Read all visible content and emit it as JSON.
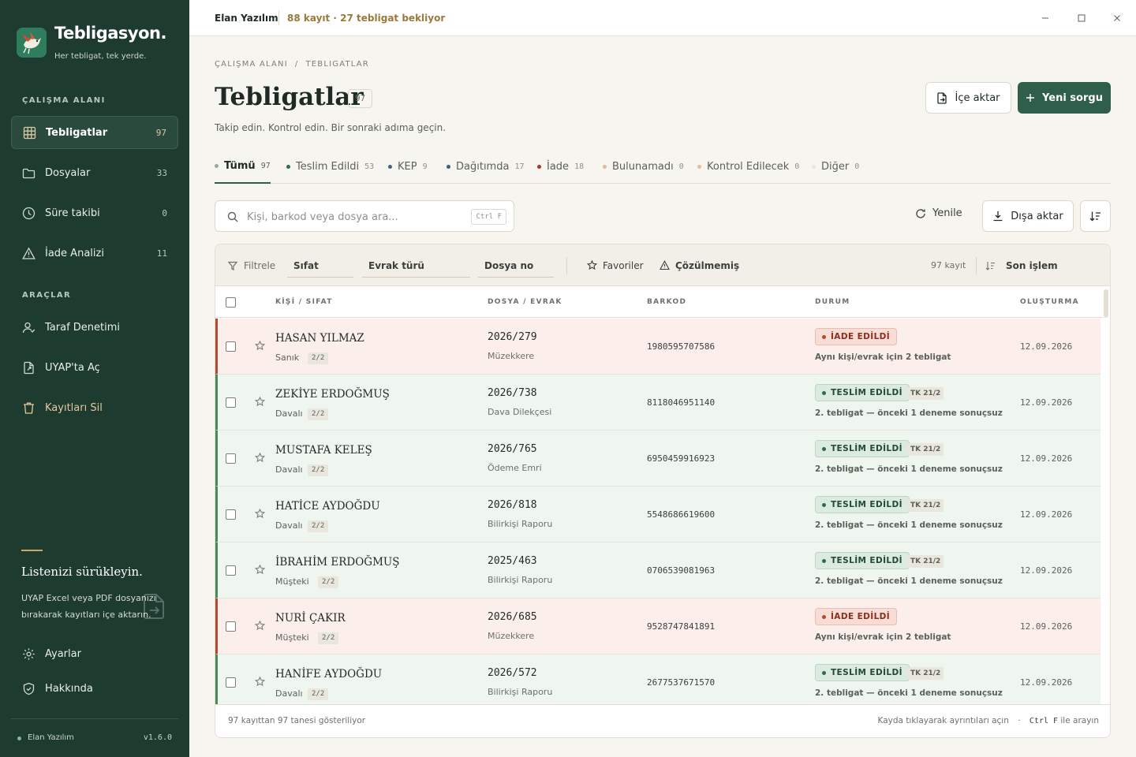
{
  "app": {
    "brand_name": "Tebligasyon.",
    "brand_tagline": "Her tebligat, tek yerde.",
    "company": "Elan Yazılım",
    "status": "88 kayıt · 27 tebligat bekliyor",
    "version": "v1.6.0"
  },
  "sidebar": {
    "section_workspace": "ÇALIŞMA ALANI",
    "section_tools": "ARAÇLAR",
    "nav": [
      {
        "label": "Tebligatlar",
        "count": "97",
        "icon": "table-icon",
        "active": true
      },
      {
        "label": "Dosyalar",
        "count": "33",
        "icon": "folder-icon"
      },
      {
        "label": "Süre takibi",
        "count": "0",
        "icon": "clock-icon"
      },
      {
        "label": "İade Analizi",
        "count": "11",
        "icon": "warning-icon"
      }
    ],
    "tools": [
      {
        "label": "Taraf Denetimi",
        "icon": "user-check-icon"
      },
      {
        "label": "UYAP'ta Aç",
        "icon": "external-file-icon"
      },
      {
        "label": "Kayıtları Sil",
        "icon": "trash-icon"
      }
    ],
    "drop_title": "Listenizi sürükleyin.",
    "drop_desc": "UYAP Excel veya PDF dosyanızı bırakarak kayıtları içe aktarın.",
    "settings_label": "Ayarlar",
    "about_label": "Hakkında"
  },
  "header": {
    "breadcrumb": [
      "ÇALIŞMA ALANI",
      "/",
      "TEBLIGATLAR"
    ],
    "title": "Tebligatlar",
    "count": "97",
    "subtitle": "Takip edin. Kontrol edin. Bir sonraki adıma geçin.",
    "import_label": "İçe aktar",
    "new_query_label": "Yeni sorgu"
  },
  "tabs": [
    {
      "label": "Tümü",
      "count": "97",
      "color": "#9aa89f",
      "active": true
    },
    {
      "label": "Teslim Edildi",
      "count": "53",
      "color": "#2f6b45"
    },
    {
      "label": "KEP",
      "count": "9",
      "color": "#4a5f86"
    },
    {
      "label": "Dağıtımda",
      "count": "17",
      "color": "#3e5f7a"
    },
    {
      "label": "İade",
      "count": "18",
      "color": "#a8361f"
    },
    {
      "label": "Bulunamadı",
      "count": "0",
      "color": "#e3b8a8"
    },
    {
      "label": "Kontrol Edilecek",
      "count": "0",
      "color": "#e8b9a2"
    },
    {
      "label": "Diğer",
      "count": "0",
      "color": "#e8e6dd"
    }
  ],
  "toolbar": {
    "search_placeholder": "Kişi, barkod veya dosya ara...",
    "search_shortcut": "Ctrl F",
    "refresh_label": "Yenile",
    "export_label": "Dışa aktar"
  },
  "filters": {
    "filter_label": "Filtrele",
    "sifat": "Sıfat",
    "evrak": "Evrak türü",
    "dosya": "Dosya no",
    "favorites": "Favoriler",
    "unresolved": "Çözülmemiş",
    "record_count": "97 kayıt",
    "sort_label": "Son işlem"
  },
  "table": {
    "columns": [
      "KİŞİ / SIFAT",
      "DOSYA / EVRAK",
      "BARKOD",
      "DURUM",
      "OLUŞTURMA"
    ],
    "rows": [
      {
        "name": "HASAN YILMAZ",
        "role": "Sanık",
        "pill": "2/2",
        "file": "2026/279",
        "doc": "Müzekkere",
        "barcode": "1980595707586",
        "status": "İADE EDİLDİ",
        "kind": "iade",
        "tk": "",
        "note": "Aynı kişi/evrak için 2 tebligat",
        "date": "12.09.2026"
      },
      {
        "name": "ZEKİYE ERDOĞMUŞ",
        "role": "Davalı",
        "pill": "2/2",
        "file": "2026/738",
        "doc": "Dava Dilekçesi",
        "barcode": "8118046951140",
        "status": "TESLİM EDİLDİ",
        "kind": "teslim",
        "tk": "TK 21/2",
        "note": "2. tebligat — önceki 1 deneme sonuçsuz",
        "date": "12.09.2026"
      },
      {
        "name": "MUSTAFA KELEŞ",
        "role": "Davalı",
        "pill": "2/2",
        "file": "2026/765",
        "doc": "Ödeme Emri",
        "barcode": "6950459916923",
        "status": "TESLİM EDİLDİ",
        "kind": "teslim",
        "tk": "TK 21/2",
        "note": "2. tebligat — önceki 1 deneme sonuçsuz",
        "date": "12.09.2026"
      },
      {
        "name": "HATİCE AYDOĞDU",
        "role": "Davalı",
        "pill": "2/2",
        "file": "2026/818",
        "doc": "Bilirkişi Raporu",
        "barcode": "5548686619600",
        "status": "TESLİM EDİLDİ",
        "kind": "teslim",
        "tk": "TK 21/2",
        "note": "2. tebligat — önceki 1 deneme sonuçsuz",
        "date": "12.09.2026"
      },
      {
        "name": "İBRAHİM ERDOĞMUŞ",
        "role": "Müşteki",
        "pill": "2/2",
        "file": "2025/463",
        "doc": "Bilirkişi Raporu",
        "barcode": "0706539081963",
        "status": "TESLİM EDİLDİ",
        "kind": "teslim",
        "tk": "TK 21/2",
        "note": "2. tebligat — önceki 1 deneme sonuçsuz",
        "date": "12.09.2026"
      },
      {
        "name": "NURİ ÇAKIR",
        "role": "Müşteki",
        "pill": "2/2",
        "file": "2026/685",
        "doc": "Müzekkere",
        "barcode": "9528747841891",
        "status": "İADE EDİLDİ",
        "kind": "iade",
        "tk": "",
        "note": "Aynı kişi/evrak için 2 tebligat",
        "date": "12.09.2026"
      },
      {
        "name": "HANİFE AYDOĞDU",
        "role": "Davalı",
        "pill": "2/2",
        "file": "2026/572",
        "doc": "Bilirkişi Raporu",
        "barcode": "2677537671570",
        "status": "TESLİM EDİLDİ",
        "kind": "teslim",
        "tk": "TK 21/2",
        "note": "2. tebligat — önceki 1 deneme sonuçsuz",
        "date": "12.09.2026"
      }
    ]
  },
  "footer": {
    "left": "97 kayıttan 97 tanesi gösteriliyor",
    "right_prefix": "Kayda tıklayarak ayrıntıları açın",
    "right_sep": "·",
    "right_kbd": "Ctrl F",
    "right_suffix": "ile arayın"
  }
}
